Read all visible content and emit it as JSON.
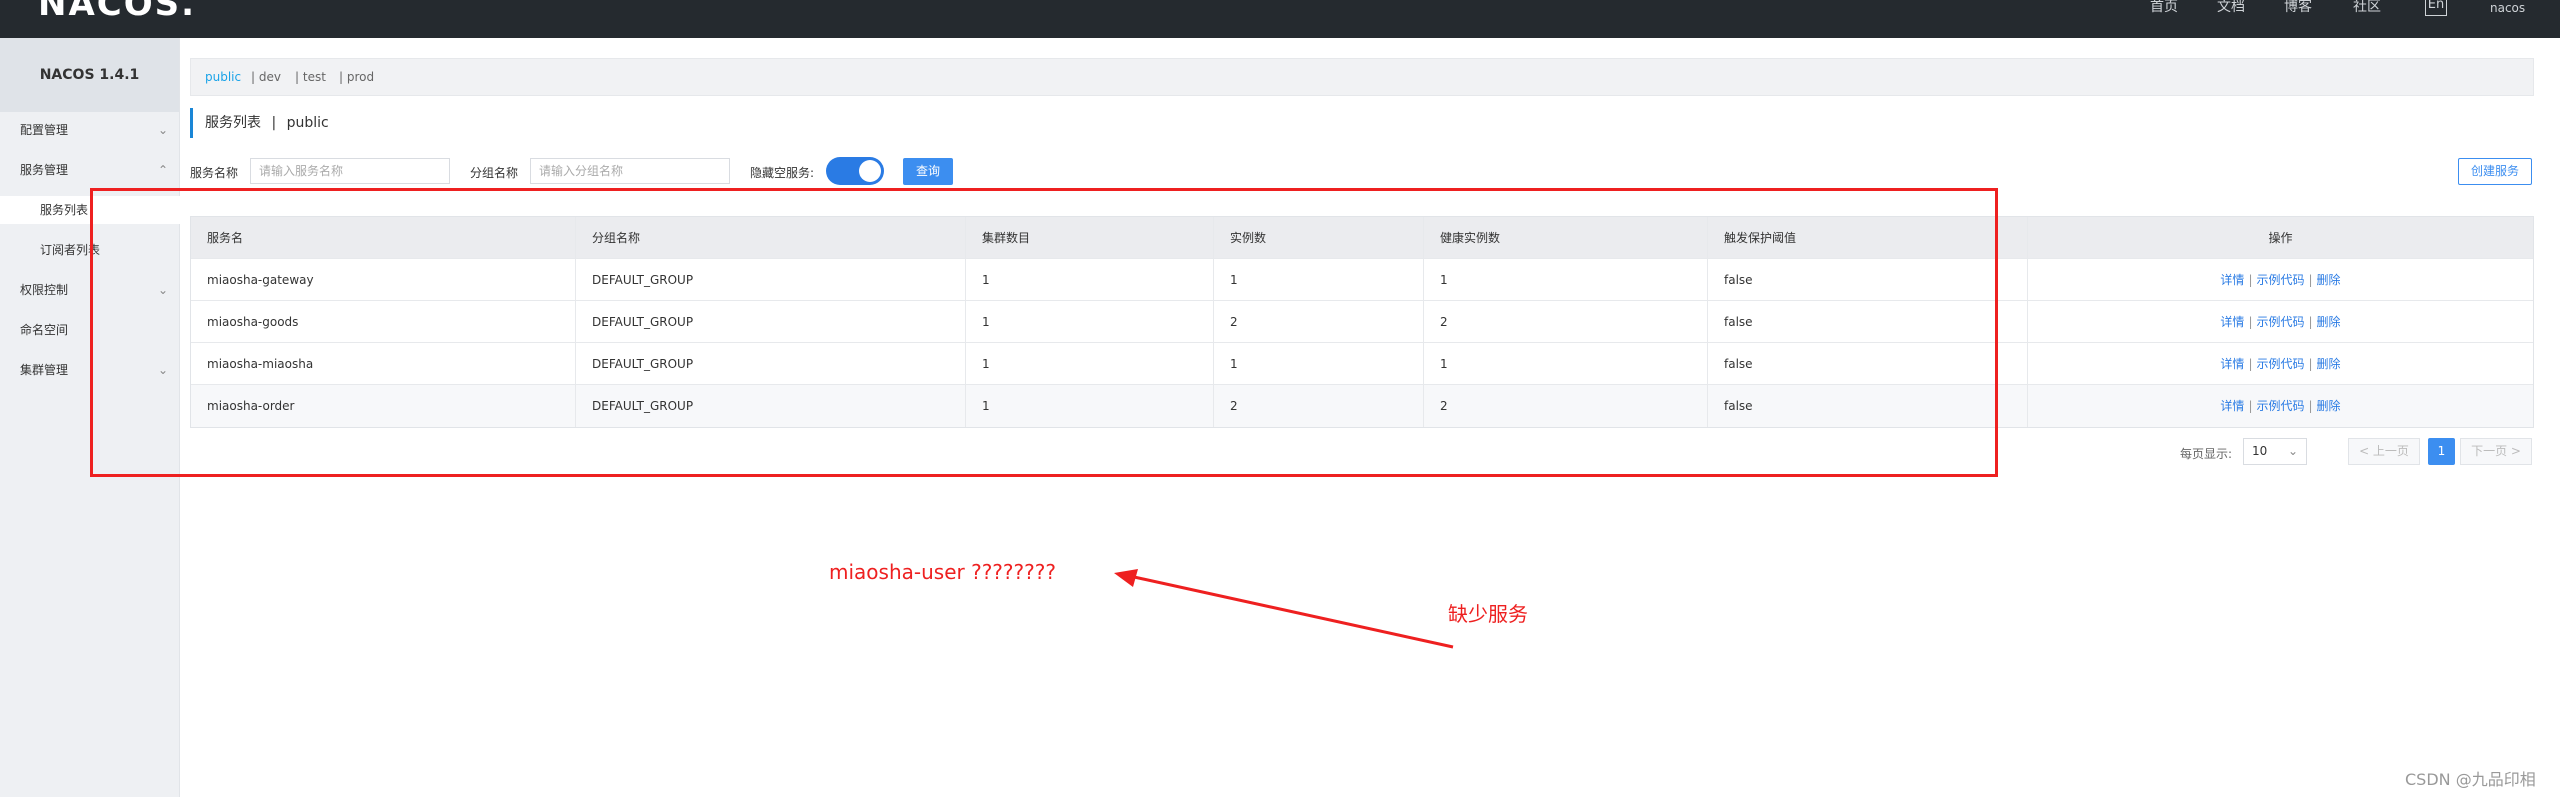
{
  "header": {
    "logo": "NACOS.",
    "nav": [
      "首页",
      "文档",
      "博客",
      "社区"
    ],
    "lang": "En",
    "user": "nacos"
  },
  "sidebar": {
    "title": "NACOS 1.4.1",
    "items": [
      {
        "label": "配置管理",
        "has_chevron": true,
        "chevron": "⌄"
      },
      {
        "label": "服务管理",
        "has_chevron": true,
        "chevron": "⌃"
      },
      {
        "label": "服务列表"
      },
      {
        "label": "订阅者列表"
      },
      {
        "label": "权限控制",
        "has_chevron": true,
        "chevron": "⌄"
      },
      {
        "label": "命名空间"
      },
      {
        "label": "集群管理",
        "has_chevron": true,
        "chevron": "⌄"
      }
    ]
  },
  "namespaces": [
    "public",
    "| dev",
    "| test",
    "| prod"
  ],
  "page": {
    "title": "服务列表",
    "separator": "|",
    "namespace": "public"
  },
  "search": {
    "service_label": "服务名称",
    "service_placeholder": "请输入服务名称",
    "group_label": "分组名称",
    "group_placeholder": "请输入分组名称",
    "hide_empty_label": "隐藏空服务:",
    "query_button": "查询",
    "create_button": "创建服务"
  },
  "table": {
    "columns": [
      "服务名",
      "分组名称",
      "集群数目",
      "实例数",
      "健康实例数",
      "触发保护阈值",
      "操作"
    ],
    "rows": [
      [
        "miaosha-gateway",
        "DEFAULT_GROUP",
        "1",
        "1",
        "1",
        "false"
      ],
      [
        "miaosha-goods",
        "DEFAULT_GROUP",
        "1",
        "2",
        "2",
        "false"
      ],
      [
        "miaosha-miaosha",
        "DEFAULT_GROUP",
        "1",
        "1",
        "1",
        "false"
      ],
      [
        "miaosha-order",
        "DEFAULT_GROUP",
        "1",
        "2",
        "2",
        "false"
      ]
    ],
    "ops": {
      "detail": "详情",
      "sample": "示例代码",
      "delete": "删除",
      "sep": "|"
    }
  },
  "pagination": {
    "per_page_label": "每页显示:",
    "per_page": "10",
    "prev": "< 上一页",
    "current": "1",
    "next": "下一页 >"
  },
  "annotations": {
    "missing_service": "miaosha-user ????????",
    "missing_note": "缺少服务",
    "color": "#ee2020"
  },
  "watermark": "CSDN @九品印相"
}
